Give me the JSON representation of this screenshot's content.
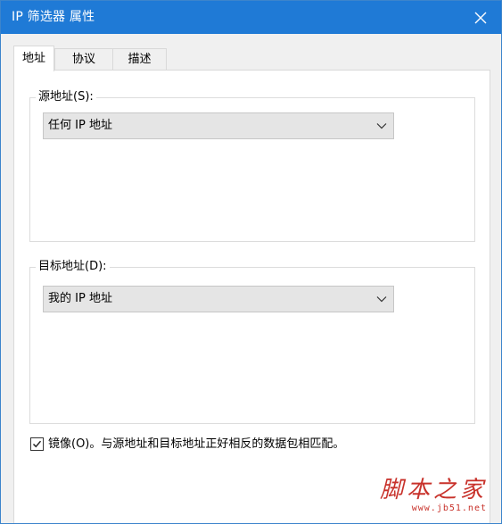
{
  "window": {
    "title": "IP 筛选器 属性"
  },
  "tabs": [
    {
      "label": "地址",
      "active": true
    },
    {
      "label": "协议",
      "active": false
    },
    {
      "label": "描述",
      "active": false
    }
  ],
  "source": {
    "label": "源地址(S):",
    "selected": "任何 IP 地址"
  },
  "destination": {
    "label": "目标地址(D):",
    "selected": "我的 IP 地址"
  },
  "mirror": {
    "checked": true,
    "label": "镜像(O)。与源地址和目标地址正好相反的数据包相匹配。"
  },
  "watermark": {
    "main": "脚本之家",
    "url": "www.jb51.net"
  },
  "colors": {
    "titlebar": "#1f7ad6",
    "watermark": "#c8322b"
  }
}
